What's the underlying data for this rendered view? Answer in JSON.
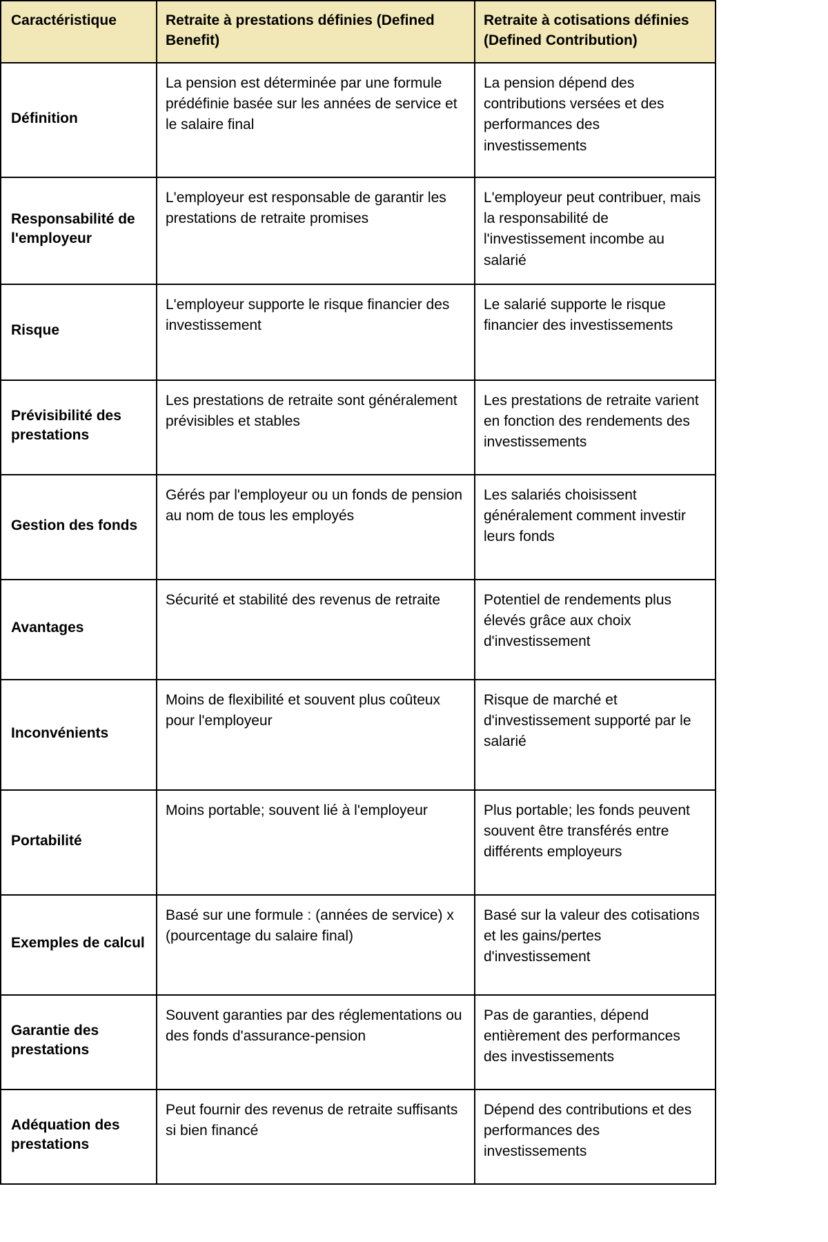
{
  "table": {
    "headers": [
      "Caractéristique",
      "Retraite à prestations définies (Defined Benefit)",
      "Retraite à cotisations définies (Defined Contribution)"
    ],
    "header_background": "#F2E7B6",
    "border_color": "#000000",
    "rows": [
      {
        "feature": "Définition",
        "defined_benefit": "La pension est déterminée par une formule prédéfinie basée sur les années de service et le salaire final",
        "defined_contribution": "La pension dépend des contributions versées et des performances des investissements"
      },
      {
        "feature": "Responsabilité de l'employeur",
        "defined_benefit": "L'employeur est responsable de garantir les prestations de retraite promises",
        "defined_contribution": "L'employeur peut contribuer, mais la responsabilité de l'investissement incombe au salarié"
      },
      {
        "feature": "Risque",
        "defined_benefit": "L'employeur supporte le risque financier des investissement",
        "defined_contribution": "Le salarié supporte le risque financier des investissements"
      },
      {
        "feature": "Prévisibilité des prestations",
        "defined_benefit": "Les prestations de retraite sont généralement prévisibles et stables",
        "defined_contribution": "Les prestations de retraite varient en fonction des rendements des investissements"
      },
      {
        "feature": "Gestion des fonds",
        "defined_benefit": "Gérés par l'employeur ou un fonds de pension au nom de tous les employés",
        "defined_contribution": "Les salariés choisissent généralement comment investir leurs fonds"
      },
      {
        "feature": "Avantages",
        "defined_benefit": "Sécurité et stabilité des revenus de retraite",
        "defined_contribution": "Potentiel de rendements plus élevés grâce aux choix d'investissement"
      },
      {
        "feature": "Inconvénients",
        "defined_benefit": "Moins de flexibilité et souvent plus coûteux pour l'employeur",
        "defined_contribution": "Risque de marché et d'investissement supporté par le salarié"
      },
      {
        "feature": "Portabilité",
        "defined_benefit": "Moins portable; souvent lié à l'employeur",
        "defined_contribution": "Plus portable; les fonds peuvent souvent être transférés entre différents employeurs"
      },
      {
        "feature": "Exemples de calcul",
        "defined_benefit": "Basé sur une formule : (années de service) x (pourcentage du salaire final)",
        "defined_contribution": "Basé sur la valeur des cotisations et les gains/pertes d'investissement"
      },
      {
        "feature": "Garantie des prestations",
        "defined_benefit": "Souvent garanties par des réglementations ou des fonds d'assurance-pension",
        "defined_contribution": "Pas de garanties, dépend entièrement des performances des investissements"
      },
      {
        "feature": "Adéquation des prestations",
        "defined_benefit": "Peut fournir des revenus de retraite suffisants si bien financé",
        "defined_contribution": "Dépend des contributions et des performances des investissements"
      }
    ]
  }
}
